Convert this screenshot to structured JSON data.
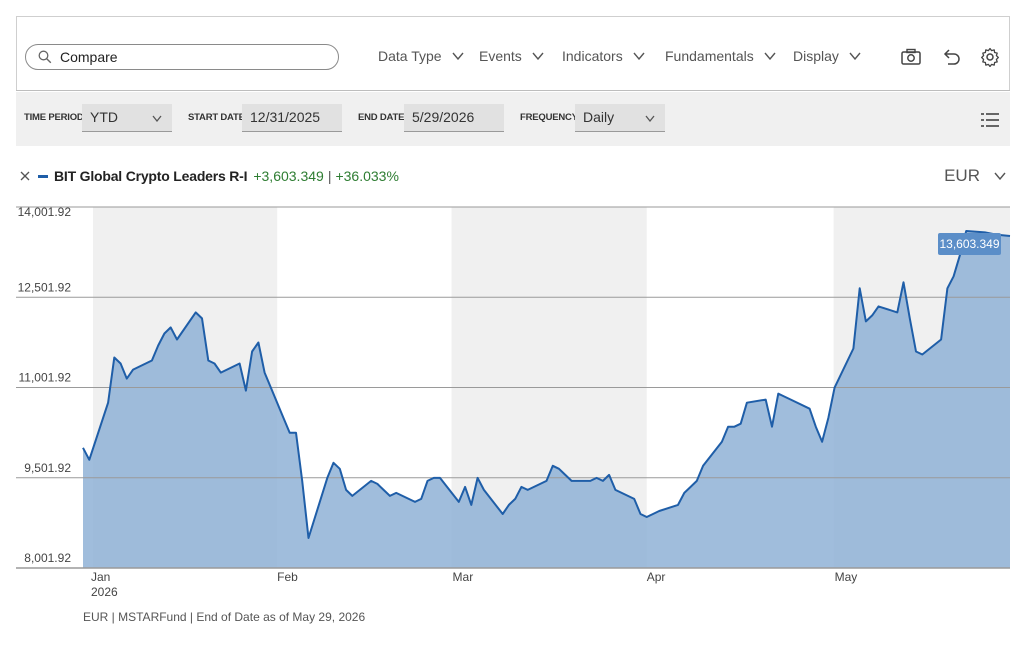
{
  "toolbar": {
    "search_placeholder": "Compare",
    "menus": [
      "Data Type",
      "Events",
      "Indicators",
      "Fundamentals",
      "Display"
    ]
  },
  "filters": {
    "time_period_label": "TIME PERIOD",
    "time_period_value": "YTD",
    "start_date_label": "START DATE",
    "start_date_value": "12/31/2025",
    "end_date_label": "END DATE",
    "end_date_value": "5/29/2026",
    "frequency_label": "FREQUENCY",
    "frequency_value": "Daily"
  },
  "legend": {
    "series_name": "BIT Global Crypto Leaders R-I",
    "change_abs": "+3,603.349",
    "separator": "|",
    "change_pct": "+36.033%",
    "color": "#1f5ea8"
  },
  "currency": "EUR",
  "footer": "EUR | MSTARFund | End of Date as of May 29, 2026",
  "chart_data": {
    "type": "area",
    "series": [
      {
        "name": "BIT Global Crypto Leaders R-I",
        "x": [
          "2026-01-01",
          "2026-01-02",
          "2026-01-05",
          "2026-01-06",
          "2026-01-07",
          "2026-01-08",
          "2026-01-09",
          "2026-01-12",
          "2026-01-13",
          "2026-01-14",
          "2026-01-15",
          "2026-01-16",
          "2026-01-19",
          "2026-01-20",
          "2026-01-21",
          "2026-01-22",
          "2026-01-23",
          "2026-01-26",
          "2026-01-27",
          "2026-01-28",
          "2026-01-29",
          "2026-01-30",
          "2026-02-02",
          "2026-02-03",
          "2026-02-04",
          "2026-02-05",
          "2026-02-06",
          "2026-02-09",
          "2026-02-10",
          "2026-02-11",
          "2026-02-12",
          "2026-02-13",
          "2026-02-16",
          "2026-02-17",
          "2026-02-18",
          "2026-02-19",
          "2026-02-20",
          "2026-02-23",
          "2026-02-24",
          "2026-02-25",
          "2026-02-26",
          "2026-02-27",
          "2026-03-02",
          "2026-03-03",
          "2026-03-04",
          "2026-03-05",
          "2026-03-06",
          "2026-03-09",
          "2026-03-10",
          "2026-03-11",
          "2026-03-12",
          "2026-03-13",
          "2026-03-16",
          "2026-03-17",
          "2026-03-18",
          "2026-03-19",
          "2026-03-20",
          "2026-03-23",
          "2026-03-24",
          "2026-03-25",
          "2026-03-26",
          "2026-03-27",
          "2026-03-30",
          "2026-03-31",
          "2026-04-01",
          "2026-04-02",
          "2026-04-03",
          "2026-04-06",
          "2026-04-07",
          "2026-04-08",
          "2026-04-09",
          "2026-04-10",
          "2026-04-13",
          "2026-04-14",
          "2026-04-15",
          "2026-04-16",
          "2026-04-17",
          "2026-04-20",
          "2026-04-21",
          "2026-04-22",
          "2026-04-23",
          "2026-04-24",
          "2026-04-27",
          "2026-04-28",
          "2026-04-29",
          "2026-04-30",
          "2026-05-01",
          "2026-05-04",
          "2026-05-05",
          "2026-05-06",
          "2026-05-07",
          "2026-05-08",
          "2026-05-11",
          "2026-05-12",
          "2026-05-13",
          "2026-05-14",
          "2026-05-15",
          "2026-05-18",
          "2026-05-19",
          "2026-05-20",
          "2026-05-21",
          "2026-05-22",
          "2026-05-25",
          "2026-05-26",
          "2026-05-27",
          "2026-05-28",
          "2026-05-29"
        ],
        "values": [
          10000,
          9800,
          10750,
          11500,
          11400,
          11150,
          11300,
          11450,
          11700,
          11900,
          12000,
          11800,
          12250,
          12150,
          11450,
          11400,
          11250,
          11400,
          10950,
          11600,
          11750,
          11250,
          10500,
          10250,
          10250,
          9450,
          8500,
          9500,
          9750,
          9650,
          9300,
          9200,
          9450,
          9400,
          9300,
          9200,
          9250,
          9100,
          9150,
          9450,
          9500,
          9500,
          9100,
          9350,
          9050,
          9500,
          9300,
          8900,
          9050,
          9150,
          9350,
          9300,
          9450,
          9700,
          9650,
          9550,
          9450,
          9450,
          9500,
          9450,
          9550,
          9300,
          9150,
          8900,
          8850,
          8900,
          8950,
          9050,
          9250,
          9350,
          9450,
          9700,
          10100,
          10350,
          10350,
          10400,
          10750,
          10800,
          10350,
          10900,
          10850,
          10800,
          10650,
          10350,
          10100,
          10500,
          11000,
          11650,
          12650,
          12100,
          12200,
          12350,
          12250,
          12750,
          12150,
          11600,
          11550,
          11800,
          12650,
          12850,
          13200,
          13603.349,
          13580,
          13560,
          13540,
          13530,
          13520
        ],
        "end_label": "13,603.349"
      }
    ],
    "yticks": [
      "8,001.92",
      "9,501.92",
      "11,001.92",
      "12,501.92",
      "14,001.92"
    ],
    "ylim": [
      8001.92,
      14001.92
    ],
    "xticks": [
      {
        "label": "Jan",
        "sub": "2026",
        "date": "2026-01-01"
      },
      {
        "label": "Feb",
        "date": "2026-02-01"
      },
      {
        "label": "Mar",
        "date": "2026-03-01"
      },
      {
        "label": "Apr",
        "date": "2026-04-01"
      },
      {
        "label": "May",
        "date": "2026-05-01"
      }
    ],
    "shaded_months": [
      "Jan",
      "Mar",
      "May"
    ],
    "grid": true,
    "line_color": "#1f5ea8",
    "fill_color": "#8fb2d6",
    "shade_color": "#f0f0f0"
  }
}
